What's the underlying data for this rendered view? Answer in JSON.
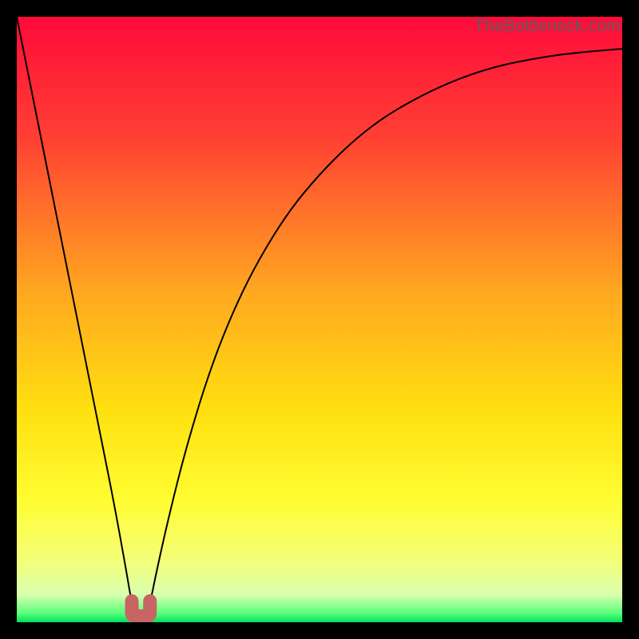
{
  "watermark": "TheBottleneck.com",
  "chart_data": {
    "type": "line",
    "title": "",
    "xlabel": "",
    "ylabel": "",
    "xlim": [
      0,
      100
    ],
    "ylim": [
      0,
      100
    ],
    "grid": false,
    "legend": false,
    "series": [
      {
        "name": "bottleneck-curve",
        "x": [
          0,
          2,
          4,
          6,
          8,
          10,
          12,
          14,
          16,
          18,
          19,
          20,
          21,
          22,
          23,
          25,
          28,
          32,
          36,
          40,
          45,
          50,
          55,
          60,
          65,
          70,
          75,
          80,
          85,
          90,
          95,
          100
        ],
        "y": [
          100,
          90,
          80,
          70,
          60,
          50,
          40,
          30,
          20,
          9,
          3,
          1,
          1,
          3,
          8,
          17,
          29,
          42,
          52,
          60,
          68,
          74,
          79,
          83,
          86,
          88.5,
          90.5,
          92,
          93,
          93.8,
          94.3,
          94.7
        ]
      }
    ],
    "marker": {
      "name": "optimal-range-marker",
      "x_range": [
        19,
        22
      ],
      "y": 1,
      "color": "#c86464"
    },
    "background_gradient": {
      "stops": [
        {
          "offset": 0.0,
          "color": "#ff0a3a"
        },
        {
          "offset": 0.2,
          "color": "#ff4033"
        },
        {
          "offset": 0.45,
          "color": "#ffa620"
        },
        {
          "offset": 0.65,
          "color": "#ffe010"
        },
        {
          "offset": 0.8,
          "color": "#fffd33"
        },
        {
          "offset": 0.9,
          "color": "#f4ff7a"
        },
        {
          "offset": 0.955,
          "color": "#d8ffb0"
        },
        {
          "offset": 0.985,
          "color": "#5aff7a"
        },
        {
          "offset": 1.0,
          "color": "#00e060"
        }
      ]
    }
  }
}
